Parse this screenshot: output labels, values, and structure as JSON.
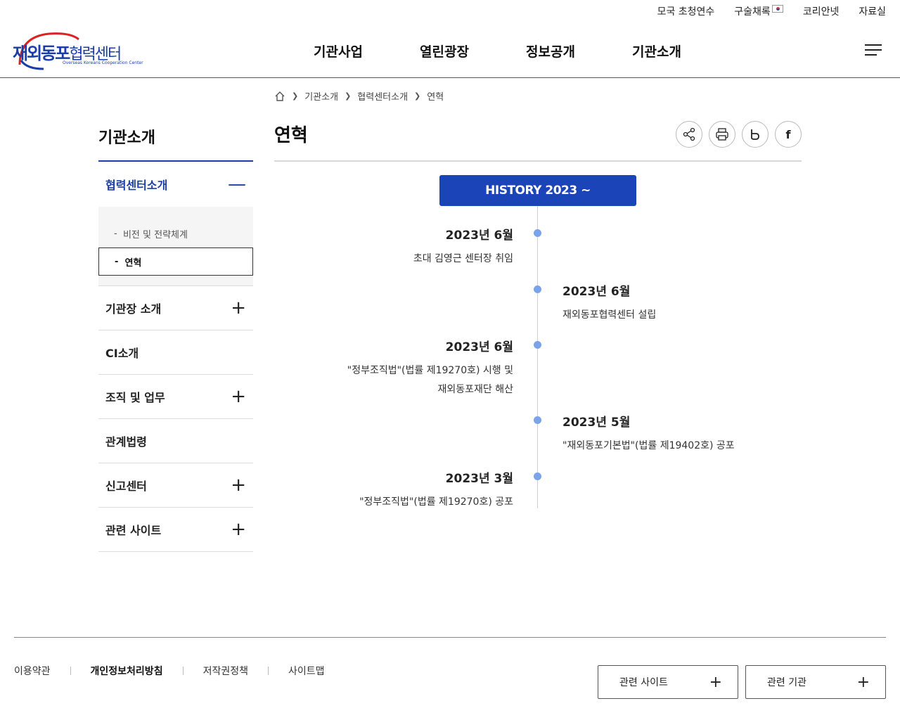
{
  "util_links": [
    "모국 초청연수",
    "구술채록",
    "코리안넷",
    "자료실"
  ],
  "logo": {
    "name_main": "재외동포",
    "name_sub": "협력센터",
    "name_en": "Overseas Koreans Cooperation Center"
  },
  "gnb": [
    "기관사업",
    "열린광장",
    "정보공개",
    "기관소개"
  ],
  "breadcrumb": [
    "기관소개",
    "협력센터소개",
    "연혁"
  ],
  "lnb": {
    "title": "기관소개",
    "active_label": "협력센터소개",
    "sub_items": [
      "비전 및 전략체계",
      "연혁"
    ],
    "items": [
      {
        "label": "기관장 소개",
        "expand": "+"
      },
      {
        "label": "CI소개",
        "expand": ""
      },
      {
        "label": "조직 및 업무",
        "expand": "+"
      },
      {
        "label": "관계법령",
        "expand": ""
      },
      {
        "label": "신고센터",
        "expand": "+"
      },
      {
        "label": "관련 사이트",
        "expand": "+"
      }
    ]
  },
  "content": {
    "title": "연혁",
    "history_badge": "HISTORY 2023 ~",
    "events": [
      {
        "date": "2023년 6월",
        "desc": [
          "초대 김영근 센터장 취임"
        ],
        "side": "left"
      },
      {
        "date": "2023년 6월",
        "desc": [
          "재외동포협력센터 설립"
        ],
        "side": "right"
      },
      {
        "date": "2023년 6월",
        "desc": [
          "\"정부조직법\"(법률 제19270호) 시행 및",
          "재외동포재단 해산"
        ],
        "side": "left"
      },
      {
        "date": "2023년 5월",
        "desc": [
          "\"재외동포기본법\"(법률 제19402호) 공포"
        ],
        "side": "right"
      },
      {
        "date": "2023년 3월",
        "desc": [
          "\"정부조직법\"(법률 제19270호) 공포"
        ],
        "side": "left"
      }
    ]
  },
  "share_icons": [
    "share-icon",
    "print-icon",
    "blog-icon",
    "facebook-icon"
  ],
  "footer": {
    "links": [
      "이용약관",
      "개인정보처리방침",
      "저작권정책",
      "사이트맵"
    ],
    "related_site": "관련 사이트",
    "related_org": "관련 기관"
  },
  "colors": {
    "primary": "#1a44b8",
    "dot": "#7ba3e8"
  }
}
